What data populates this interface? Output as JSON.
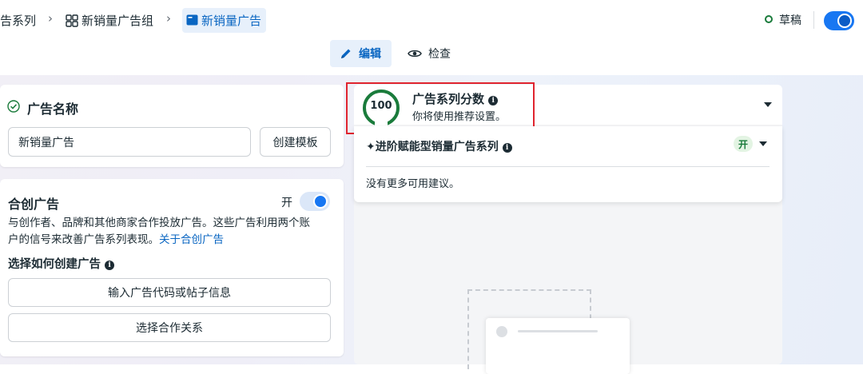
{
  "breadcrumb": {
    "campaign": "告系列",
    "adset": "新销量广告组",
    "ad": "新销量广告"
  },
  "status": {
    "label": "草稿"
  },
  "tabs": {
    "edit": "编辑",
    "check": "检查"
  },
  "ad_name_card": {
    "title": "广告名称",
    "input_value": "新销量广告",
    "template_button": "创建模板"
  },
  "partnership_card": {
    "title": "合创广告",
    "toggle_label": "开",
    "description_line1": "与创作者、品牌和其他商家合作投放广告。这些广告利用两个账",
    "description_line2": "户的信号来改善广告系列表现。",
    "link": "关于合创广告",
    "choose_title": "选择如何创建广告",
    "button_code": "输入广告代码或帖子信息",
    "button_partner": "选择合作关系"
  },
  "score_card": {
    "score": "100",
    "score_value": 100,
    "title": "广告系列分数",
    "subtitle": "你将使用推荐设置。"
  },
  "recommendation": {
    "title": "进阶赋能型销量广告系列",
    "badge": "开",
    "empty_text": "没有更多可用建议。"
  },
  "colors": {
    "accent": "#1877f2",
    "score_ring": "#1a7b3b",
    "highlight_border": "#e0242e"
  }
}
